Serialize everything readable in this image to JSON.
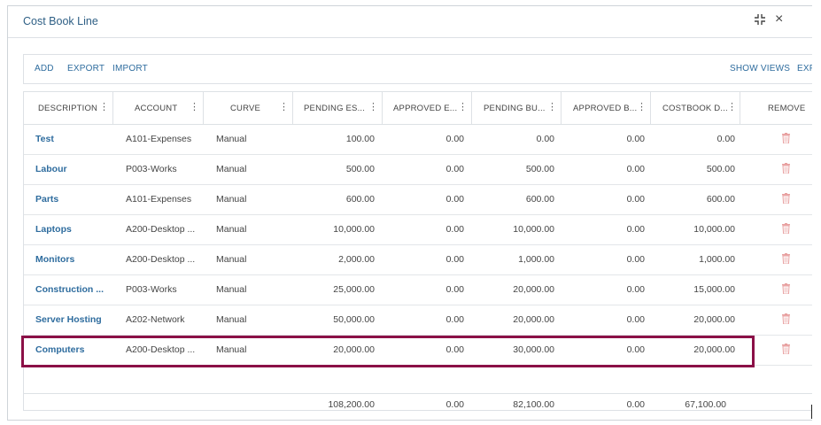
{
  "dialog": {
    "title": "Cost Book Line",
    "collapse_icon": "compress-icon",
    "close_icon": "close-icon",
    "close_glyph": "×"
  },
  "toolbar": {
    "add": "ADD",
    "export": "EXPORT",
    "import": "IMPORT",
    "show_views": "SHOW VIEWS",
    "expand_truncated": "EXP"
  },
  "columns": [
    {
      "label": "DESCRIPTION"
    },
    {
      "label": "ACCOUNT"
    },
    {
      "label": "CURVE"
    },
    {
      "label": "PENDING ES..."
    },
    {
      "label": "APPROVED E..."
    },
    {
      "label": "PENDING BU..."
    },
    {
      "label": "APPROVED B..."
    },
    {
      "label": "COSTBOOK D..."
    },
    {
      "label": "REMOVE"
    }
  ],
  "menu_glyph": "⋮",
  "rows": [
    {
      "description": "Test",
      "account": "A101-Expenses",
      "curve": "Manual",
      "pending_est": "100.00",
      "approved_est": "0.00",
      "pending_bud": "0.00",
      "approved_bud": "0.00",
      "costbook_d": "0.00"
    },
    {
      "description": "Labour",
      "account": "P003-Works",
      "curve": "Manual",
      "pending_est": "500.00",
      "approved_est": "0.00",
      "pending_bud": "500.00",
      "approved_bud": "0.00",
      "costbook_d": "500.00"
    },
    {
      "description": "Parts",
      "account": "A101-Expenses",
      "curve": "Manual",
      "pending_est": "600.00",
      "approved_est": "0.00",
      "pending_bud": "600.00",
      "approved_bud": "0.00",
      "costbook_d": "600.00"
    },
    {
      "description": "Laptops",
      "account": "A200-Desktop ...",
      "curve": "Manual",
      "pending_est": "10,000.00",
      "approved_est": "0.00",
      "pending_bud": "10,000.00",
      "approved_bud": "0.00",
      "costbook_d": "10,000.00"
    },
    {
      "description": "Monitors",
      "account": "A200-Desktop ...",
      "curve": "Manual",
      "pending_est": "2,000.00",
      "approved_est": "0.00",
      "pending_bud": "1,000.00",
      "approved_bud": "0.00",
      "costbook_d": "1,000.00"
    },
    {
      "description": "Construction ...",
      "account": "P003-Works",
      "curve": "Manual",
      "pending_est": "25,000.00",
      "approved_est": "0.00",
      "pending_bud": "20,000.00",
      "approved_bud": "0.00",
      "costbook_d": "15,000.00"
    },
    {
      "description": "Server Hosting",
      "account": "A202-Network",
      "curve": "Manual",
      "pending_est": "50,000.00",
      "approved_est": "0.00",
      "pending_bud": "20,000.00",
      "approved_bud": "0.00",
      "costbook_d": "20,000.00"
    },
    {
      "description": "Computers",
      "account": "A200-Desktop ...",
      "curve": "Manual",
      "pending_est": "20,000.00",
      "approved_est": "0.00",
      "pending_bud": "30,000.00",
      "approved_bud": "0.00",
      "costbook_d": "20,000.00"
    }
  ],
  "totals": {
    "pending_est": "108,200.00",
    "approved_est": "0.00",
    "pending_bud": "82,100.00",
    "approved_bud": "0.00",
    "costbook_d": "67,100.00"
  },
  "colors": {
    "link": "#2e6c9e",
    "trash": "#e8a0a0",
    "highlight": "#8b1047"
  },
  "remove_icon": "trash-icon"
}
